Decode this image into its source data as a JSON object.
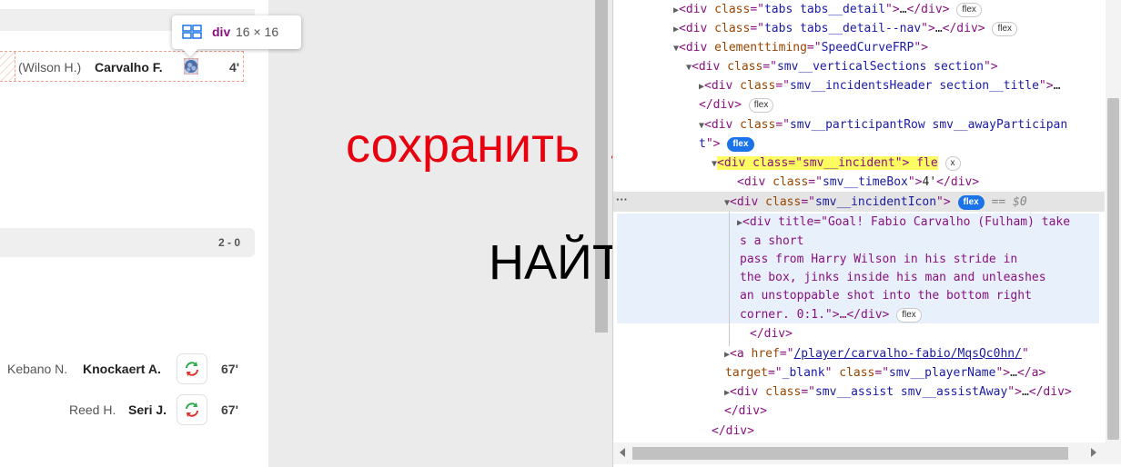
{
  "tooltip": {
    "tag": "div",
    "dims": "16 × 16"
  },
  "page": {
    "goal_row": {
      "assist": "(Wilson H.)",
      "player": "Carvalho F.",
      "minute": "4'"
    },
    "score_bar": {
      "score": "2 - 0"
    },
    "subs": [
      {
        "out": "Kebano N.",
        "in": "Knockaert A.",
        "minute": "67'"
      },
      {
        "out": "Reed H.",
        "in": "Seri J.",
        "minute": "67'"
      }
    ]
  },
  "annotations": {
    "save": "сохранить",
    "find": "НАЙТИ",
    "save_color": "#e8000e",
    "find_color": "#000000"
  },
  "devtools": {
    "l1_class": "tabs tabs__detail",
    "l1_badge": "flex",
    "l2_class": "tabs tabs__detail--nav",
    "l2_badge": "flex",
    "l3_attr": "elementtiming",
    "l3_val": "SpeedCurveFRP",
    "l4_class": "smv__verticalSections section",
    "l5_class": "smv__incidentsHeader section__title",
    "l6_badge": "flex",
    "l7_class": "smv__participantRow smv__awayParticipan",
    "l8_cont": "t",
    "l8_badge": "flex",
    "l9_text": "<div class=\"smv__incident\"> fle",
    "l9_badge": "x",
    "l10_class": "smv__timeBox",
    "l10_text": "4'",
    "l11_class": "smv__incidentIcon",
    "l11_badge": "flex",
    "l11_eq": "== $0",
    "title_lines": [
      "<div title=\"Goal! Fabio Carvalho (Fulham) take",
      "s a short",
      "pass from Harry Wilson in his stride in",
      "the box, jinks inside his man and unleashes",
      "an unstoppable shot into the bottom right",
      "corner. 0:1.\">…</div>"
    ],
    "l17_badge": "flex",
    "l19_href": "/player/carvalho-fabio/MqsQc0hn/",
    "l20_target": "_blank",
    "l20_class": "smv__playerName",
    "l21_class": "smv__assist smv__assistAway"
  }
}
